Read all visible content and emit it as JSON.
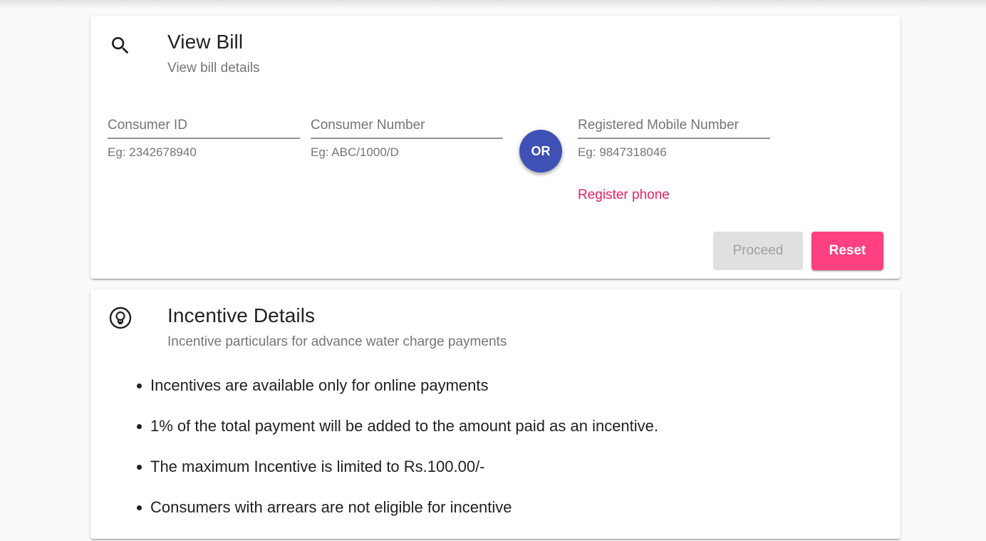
{
  "view_bill": {
    "icon": "search-icon",
    "title": "View Bill",
    "subtitle": "View bill details",
    "fields": {
      "consumer_id": {
        "placeholder": "Consumer ID",
        "value": "",
        "hint": "Eg: 2342678940"
      },
      "consumer_number": {
        "placeholder": "Consumer Number",
        "value": "",
        "hint": "Eg: ABC/1000/D"
      },
      "mobile": {
        "placeholder": "Registered Mobile Number",
        "value": "",
        "hint": "Eg: 9847318046"
      }
    },
    "or_label": "OR",
    "register_link": "Register phone",
    "proceed_label": "Proceed",
    "reset_label": "Reset"
  },
  "incentive": {
    "icon": "lightbulb-icon",
    "title": "Incentive Details",
    "subtitle": "Incentive particulars for advance water charge payments",
    "items": [
      "Incentives are available only for online payments",
      "1% of the total payment will be added to the amount paid as an incentive.",
      "The maximum Incentive is limited to Rs.100.00/-",
      "Consumers with arrears are not eligible for incentive"
    ]
  },
  "colors": {
    "primary": "#3f51b5",
    "accent": "#ff4081",
    "link": "#e91e63",
    "disabled_bg": "#e0e0e0"
  }
}
